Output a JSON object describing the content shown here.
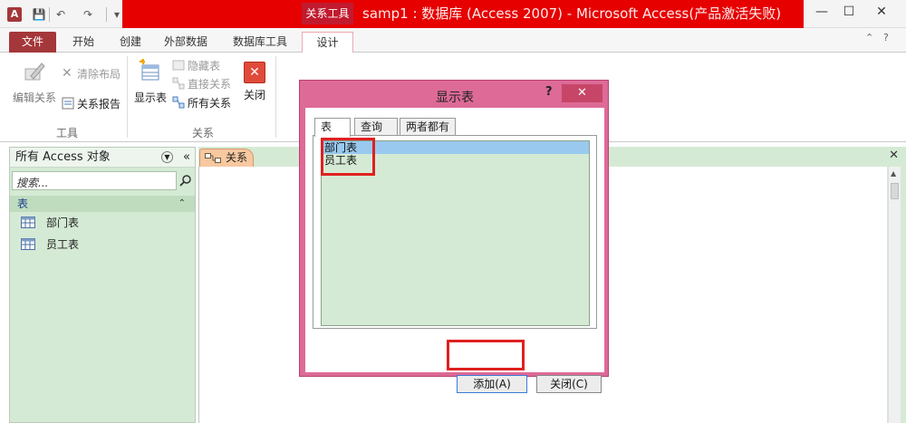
{
  "window": {
    "app_icon": "A",
    "context_tab": "关系工具",
    "title": "samp1 : 数据库 (Access 2007) - Microsoft Access(产品激活失败)",
    "controls": {
      "minimize": "—",
      "maximize": "☐",
      "close": "✕"
    }
  },
  "qat": {
    "save": "💾",
    "undo": "↶",
    "redo": "↷",
    "customize": "▾"
  },
  "ribbon_tabs": [
    "文件",
    "开始",
    "创建",
    "外部数据",
    "数据库工具",
    "设计"
  ],
  "ribbon_right": {
    "collapse": "⌃",
    "help": "?"
  },
  "ribbon": {
    "tools_group": {
      "label": "工具",
      "edit_relationships": "编辑关系",
      "clear_layout": "清除布局",
      "relationship_report": "关系报告"
    },
    "relationships_group": {
      "label": "关系",
      "show_table": "显示表",
      "hide_table": "隐藏表",
      "direct_relationships": "直接关系",
      "all_relationships": "所有关系",
      "close": "关闭"
    }
  },
  "nav_pane": {
    "title": "所有 Access 对象",
    "collapse": "«",
    "search_placeholder": "搜索...",
    "section": "表",
    "section_chevron": "⌃",
    "items": [
      "部门表",
      "员工表"
    ]
  },
  "document": {
    "tab_label": "关系",
    "close": "✕"
  },
  "dialog": {
    "title": "显示表",
    "help": "?",
    "close": "✕",
    "tabs": [
      "表",
      "查询",
      "两者都有"
    ],
    "list": [
      "部门表",
      "员工表"
    ],
    "add_button": "添加(A)",
    "close_button": "关闭(C)"
  },
  "colors": {
    "title_red": "#e60000",
    "file_tab": "#a4373a",
    "nav_green": "#d5ead5",
    "dialog_pink": "#dd6a97",
    "highlight_red": "#e02020",
    "selection_blue": "#99c9ef"
  }
}
